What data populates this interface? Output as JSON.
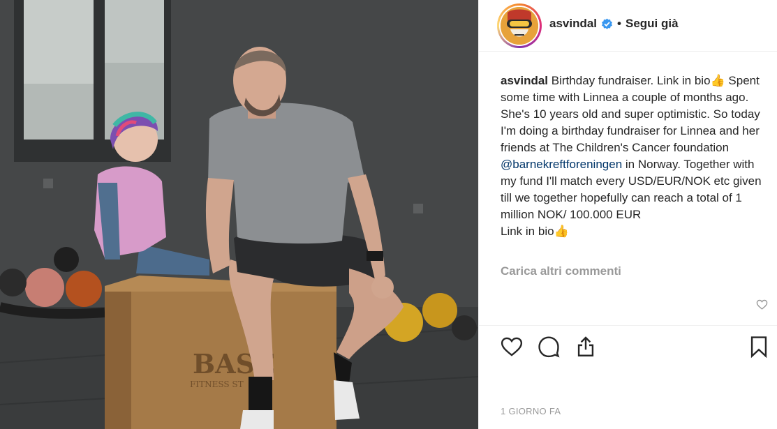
{
  "post": {
    "username": "asvindal",
    "separator": "•",
    "follow_label": "Segui già",
    "caption_user": "asvindal",
    "caption_part1": "Birthday fundraiser. Link in bio👍 Spent some time with Linnea a couple of months ago. She's 10 years old and super optimistic. So today I'm doing a birthday fundraiser for Linnea and her friends at The Children's Cancer foundation",
    "mention": "@barnekreftforeningen",
    "caption_part2": "in Norway. Together with my fund I'll match every USD/EUR/NOK etc given till we together hopefully can reach a total of 1 million NOK/ 100.000 EUR",
    "caption_part3": "Link in bio👍",
    "load_more": "Carica altri commenti",
    "timestamp": "1 GIORNO FA",
    "box_text_1": "BASE",
    "box_text_2": "FITNESS ST"
  },
  "icons": {
    "verified": "verified-badge-icon",
    "like": "heart-icon",
    "comment": "comment-icon",
    "share": "share-icon",
    "save": "bookmark-icon"
  },
  "colors": {
    "verified": "#3897f0",
    "mention": "#003569",
    "muted": "#999999",
    "text": "#262626"
  }
}
